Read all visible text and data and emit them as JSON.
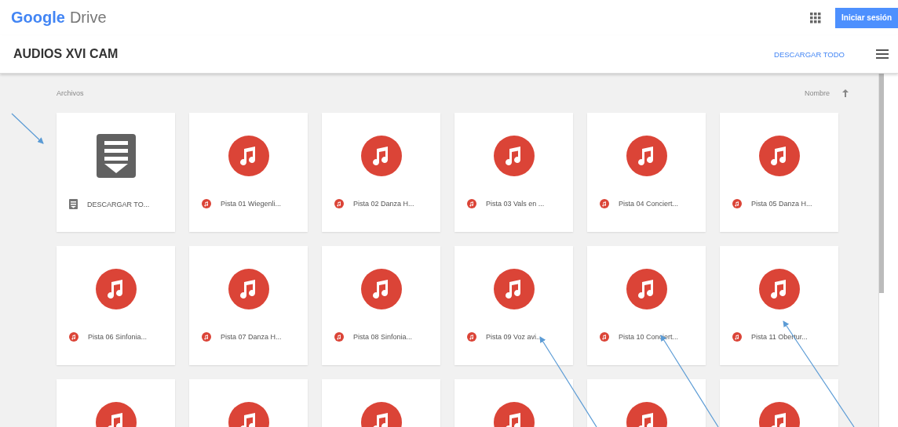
{
  "header": {
    "logo_brand": "Google",
    "logo_product": "Drive",
    "sign_in_button": "Iniciar sesión"
  },
  "folder": {
    "title": "AUDIOS XVI CAM",
    "download_all": "DESCARGAR TODO"
  },
  "files_section": {
    "label": "Archivos",
    "sort_label": "Nombre",
    "sort_ascending": true
  },
  "files": [
    {
      "kind": "archive",
      "name": "DESCARGAR TO..."
    },
    {
      "kind": "audio",
      "name": "Pista 01 Wiegenli..."
    },
    {
      "kind": "audio",
      "name": "Pista 02 Danza H..."
    },
    {
      "kind": "audio",
      "name": "Pista 03 Vals en ..."
    },
    {
      "kind": "audio",
      "name": "Pista 04 Conciert..."
    },
    {
      "kind": "audio",
      "name": "Pista 05 Danza H..."
    },
    {
      "kind": "audio",
      "name": "Pista 06 Sinfonia..."
    },
    {
      "kind": "audio",
      "name": "Pista 07 Danza H..."
    },
    {
      "kind": "audio",
      "name": "Pista 08 Sinfonia..."
    },
    {
      "kind": "audio",
      "name": "Pista 09 Voz avi..."
    },
    {
      "kind": "audio",
      "name": "Pista 10 Conciert..."
    },
    {
      "kind": "audio",
      "name": "Pista 11 Obertur..."
    },
    {
      "kind": "audio"
    },
    {
      "kind": "audio"
    },
    {
      "kind": "audio"
    },
    {
      "kind": "audio"
    },
    {
      "kind": "audio"
    },
    {
      "kind": "audio"
    }
  ],
  "annotation_arrows": [
    {
      "kind": "arrow"
    },
    {
      "kind": "arrow"
    },
    {
      "kind": "arrow"
    },
    {
      "kind": "arrow"
    }
  ]
}
